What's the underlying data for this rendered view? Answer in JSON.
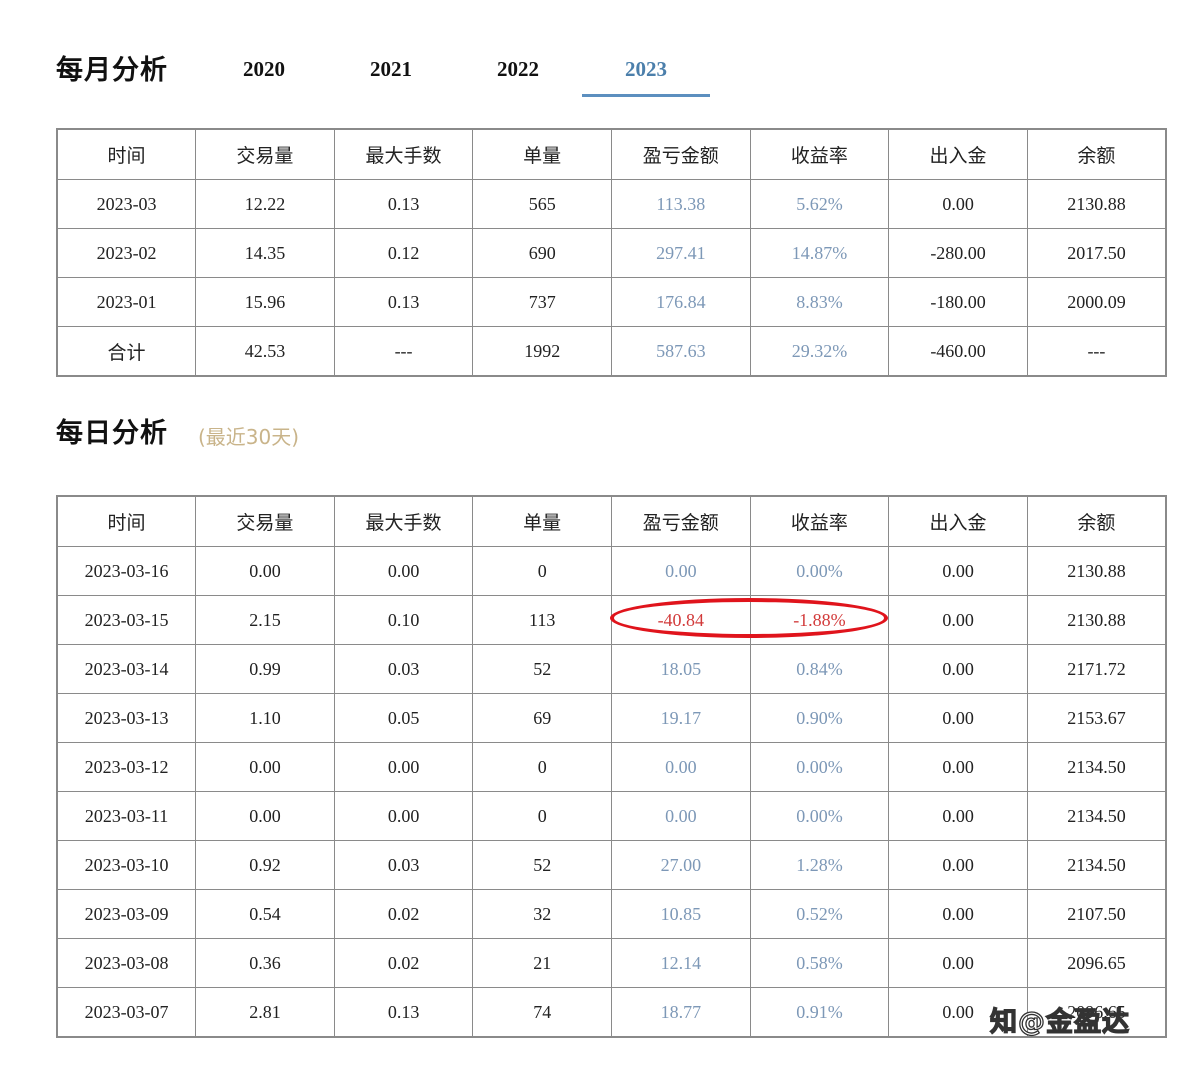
{
  "monthly": {
    "title": "每月分析",
    "tabs": [
      {
        "label": "2020",
        "active": false
      },
      {
        "label": "2021",
        "active": false
      },
      {
        "label": "2022",
        "active": false
      },
      {
        "label": "2023",
        "active": true
      }
    ],
    "headers": [
      "时间",
      "交易量",
      "最大手数",
      "单量",
      "盈亏金额",
      "收益率",
      "出入金",
      "余额"
    ],
    "rows": [
      [
        "2023-03",
        "12.22",
        "0.13",
        "565",
        "113.38",
        "5.62%",
        "0.00",
        "2130.88"
      ],
      [
        "2023-02",
        "14.35",
        "0.12",
        "690",
        "297.41",
        "14.87%",
        "-280.00",
        "2017.50"
      ],
      [
        "2023-01",
        "15.96",
        "0.13",
        "737",
        "176.84",
        "8.83%",
        "-180.00",
        "2000.09"
      ],
      [
        "合计",
        "42.53",
        "---",
        "1992",
        "587.63",
        "29.32%",
        "-460.00",
        "---"
      ]
    ]
  },
  "daily": {
    "title": "每日分析",
    "subtitle": "(最近30天)",
    "headers": [
      "时间",
      "交易量",
      "最大手数",
      "单量",
      "盈亏金额",
      "收益率",
      "出入金",
      "余额"
    ],
    "rows": [
      [
        "2023-03-16",
        "0.00",
        "0.00",
        "0",
        "0.00",
        "0.00%",
        "0.00",
        "2130.88"
      ],
      [
        "2023-03-15",
        "2.15",
        "0.10",
        "113",
        "-40.84",
        "-1.88%",
        "0.00",
        "2130.88"
      ],
      [
        "2023-03-14",
        "0.99",
        "0.03",
        "52",
        "18.05",
        "0.84%",
        "0.00",
        "2171.72"
      ],
      [
        "2023-03-13",
        "1.10",
        "0.05",
        "69",
        "19.17",
        "0.90%",
        "0.00",
        "2153.67"
      ],
      [
        "2023-03-12",
        "0.00",
        "0.00",
        "0",
        "0.00",
        "0.00%",
        "0.00",
        "2134.50"
      ],
      [
        "2023-03-11",
        "0.00",
        "0.00",
        "0",
        "0.00",
        "0.00%",
        "0.00",
        "2134.50"
      ],
      [
        "2023-03-10",
        "0.92",
        "0.03",
        "52",
        "27.00",
        "1.28%",
        "0.00",
        "2134.50"
      ],
      [
        "2023-03-09",
        "0.54",
        "0.02",
        "32",
        "10.85",
        "0.52%",
        "0.00",
        "2107.50"
      ],
      [
        "2023-03-08",
        "0.36",
        "0.02",
        "21",
        "12.14",
        "0.58%",
        "0.00",
        "2096.65"
      ],
      [
        "2023-03-07",
        "2.81",
        "0.13",
        "74",
        "18.77",
        "0.91%",
        "0.00",
        "2096.65"
      ]
    ]
  },
  "watermark": "知@金盈达",
  "colors": {
    "active_tab": "#4b7fab",
    "profit_value": "#7d98b7",
    "loss_value": "#d23a3a",
    "highlight_circle": "#e0141c",
    "subtitle_note": "#c9b48a",
    "table_border": "#8a8a8a"
  }
}
